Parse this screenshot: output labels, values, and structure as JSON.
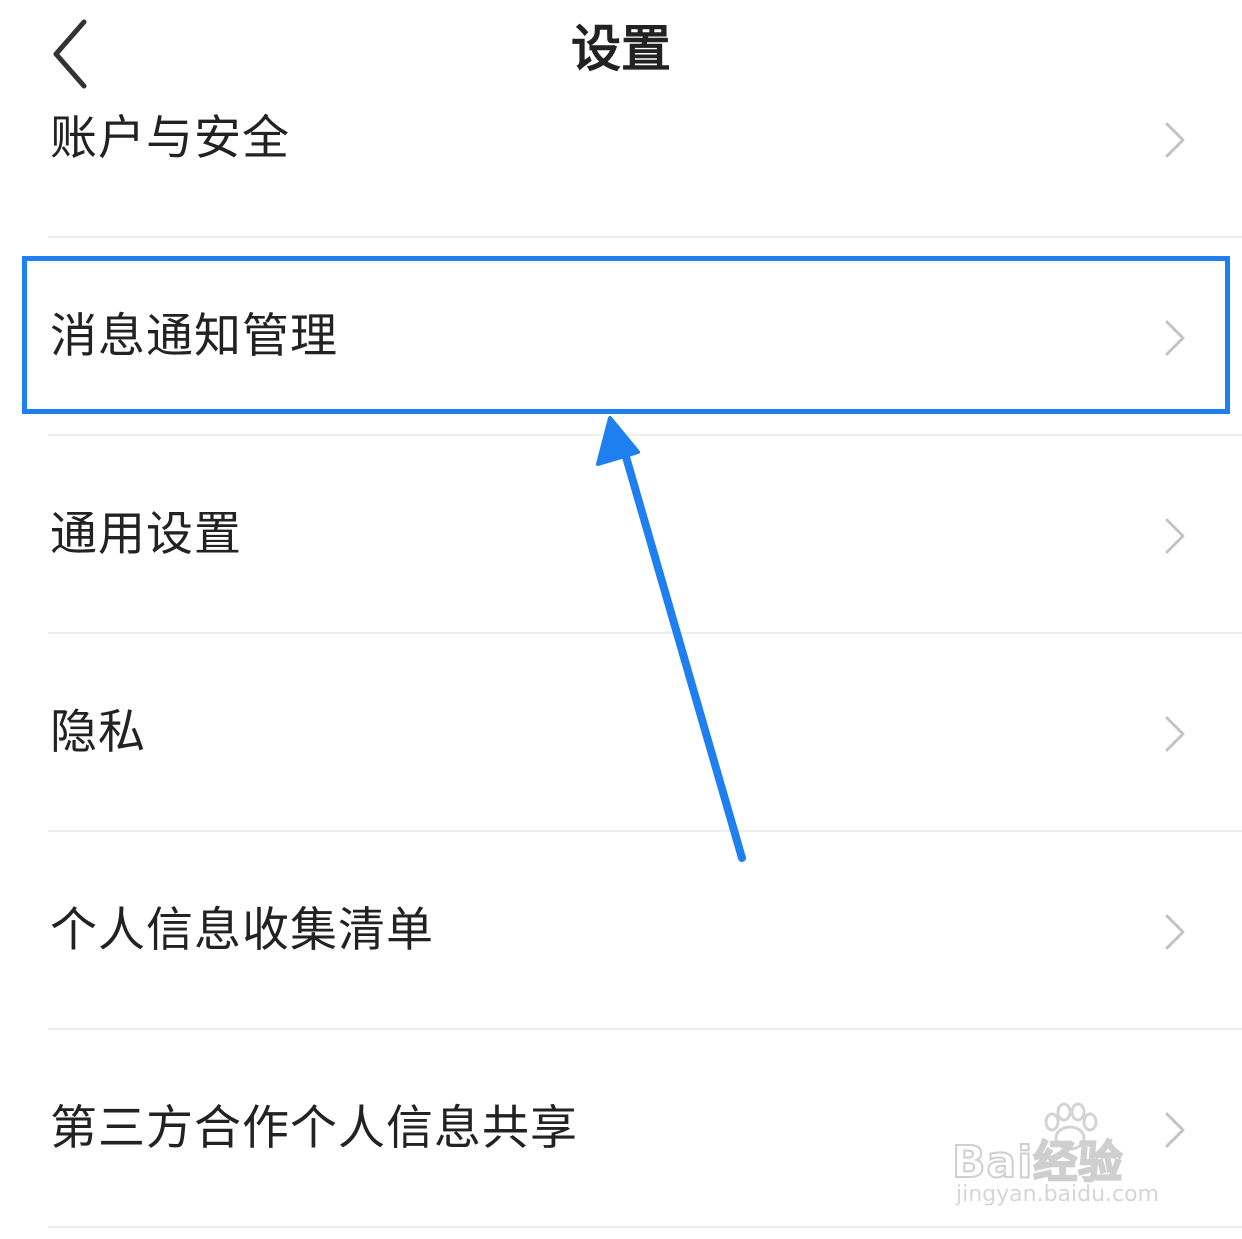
{
  "header": {
    "title": "设置",
    "back_icon": "chevron-left-icon"
  },
  "settings": [
    {
      "label": "账户与安全"
    },
    {
      "label": "消息通知管理"
    },
    {
      "label": "通用设置"
    },
    {
      "label": "隐私"
    },
    {
      "label": "个人信息收集清单"
    },
    {
      "label": "第三方合作个人信息共享"
    }
  ],
  "annotation": {
    "highlight_color": "#1e7ff0",
    "highlighted_item": "消息通知管理"
  },
  "watermark": {
    "brand": "Bai经验",
    "url": "jingyan.baidu.com"
  },
  "colors": {
    "text": "#222222",
    "chevron": "#c4c4c4",
    "divider": "#eeeeee",
    "annotation": "#1e7ff0"
  }
}
